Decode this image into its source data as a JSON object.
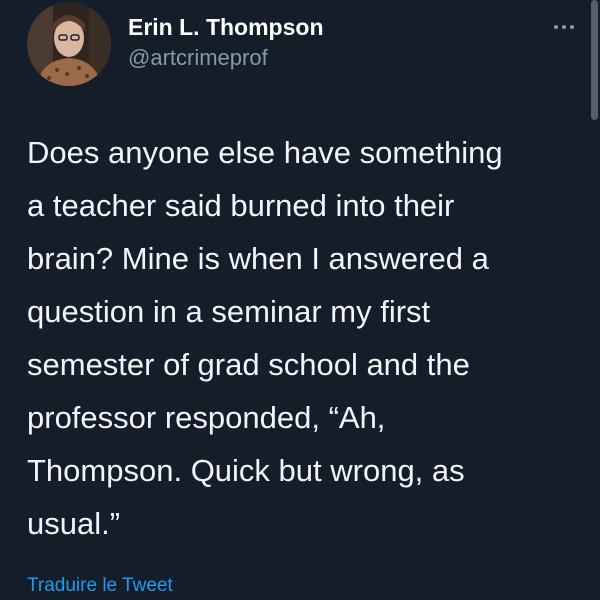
{
  "tweet": {
    "author": {
      "display_name": "Erin L. Thompson",
      "handle": "@artcrimeprof"
    },
    "text": "Does anyone else have something\na teacher said burned into their\nbrain? Mine is when I answered a\nquestion in a seminar my first\nsemester of grad school and the\nprofessor responded, “Ah,\nThompson. Quick but wrong, as\nusual.”",
    "translate_link": "Traduire le Tweet"
  },
  "icons": {
    "more": "more-horizontal-icon"
  },
  "colors": {
    "background": "#141d2a",
    "text": "#f2f4f6",
    "handle": "#8b98a5",
    "link": "#1d9bf0"
  }
}
